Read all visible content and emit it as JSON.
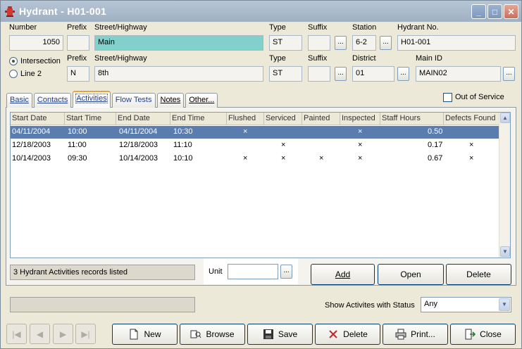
{
  "window": {
    "title": "Hydrant  - H01-001"
  },
  "row1": {
    "number_label": "Number",
    "number_value": "1050",
    "prefix_label": "Prefix",
    "prefix_value": "",
    "street_label": "Street/Highway",
    "street_value": "Main",
    "type_label": "Type",
    "type_value": "ST",
    "suffix_label": "Suffix",
    "suffix_value": "",
    "station_label": "Station",
    "station_value": "6-2",
    "hydrant_no_label": "Hydrant No.",
    "hydrant_no_value": "H01-001"
  },
  "row2": {
    "intersection_label": "Intersection",
    "line2_label": "Line 2",
    "prefix_label": "Prefix",
    "prefix_value": "N",
    "street_label": "Street/Highway",
    "street_value": "8th",
    "type_label": "Type",
    "type_value": "ST",
    "suffix_label": "Suffix",
    "suffix_value": "",
    "district_label": "District",
    "district_value": "01",
    "main_id_label": "Main ID",
    "main_id_value": "MAIN02"
  },
  "ellipsis": "...",
  "tabs": [
    "Basic",
    "Contacts",
    "Activities",
    "Flow Tests",
    "Notes",
    "Other..."
  ],
  "active_tab": "Activities",
  "out_of_service_label": "Out of Service",
  "grid": {
    "columns": [
      "Start Date",
      "Start Time",
      "End Date",
      "End Time",
      "Flushed",
      "Serviced",
      "Painted",
      "Inspected",
      "Staff Hours",
      "Defects Found"
    ],
    "rows": [
      {
        "start_date": "04/11/2004",
        "start_time": "10:00",
        "end_date": "04/11/2004",
        "end_time": "10:30",
        "flushed": "×",
        "serviced": "",
        "painted": "",
        "inspected": "×",
        "staff_hours": "0.50",
        "defects": "",
        "selected": true
      },
      {
        "start_date": "12/18/2003",
        "start_time": "11:00",
        "end_date": "12/18/2003",
        "end_time": "11:10",
        "flushed": "",
        "serviced": "×",
        "painted": "",
        "inspected": "×",
        "staff_hours": "0.17",
        "defects": "×",
        "selected": false
      },
      {
        "start_date": "10/14/2003",
        "start_time": "09:30",
        "end_date": "10/14/2003",
        "end_time": "10:10",
        "flushed": "×",
        "serviced": "×",
        "painted": "×",
        "inspected": "×",
        "staff_hours": "0.67",
        "defects": "×",
        "selected": false
      }
    ]
  },
  "status_text": "3 Hydrant Activities records listed",
  "unit_label": "Unit",
  "unit_value": "",
  "buttons": {
    "add": "Add",
    "open": "Open",
    "delete": "Delete"
  },
  "show_status_label": "Show Activites with Status",
  "show_status_value": "Any",
  "toolbar": {
    "new": "New",
    "browse": "Browse",
    "save": "Save",
    "delete": "Delete",
    "print": "Print...",
    "close": "Close"
  }
}
